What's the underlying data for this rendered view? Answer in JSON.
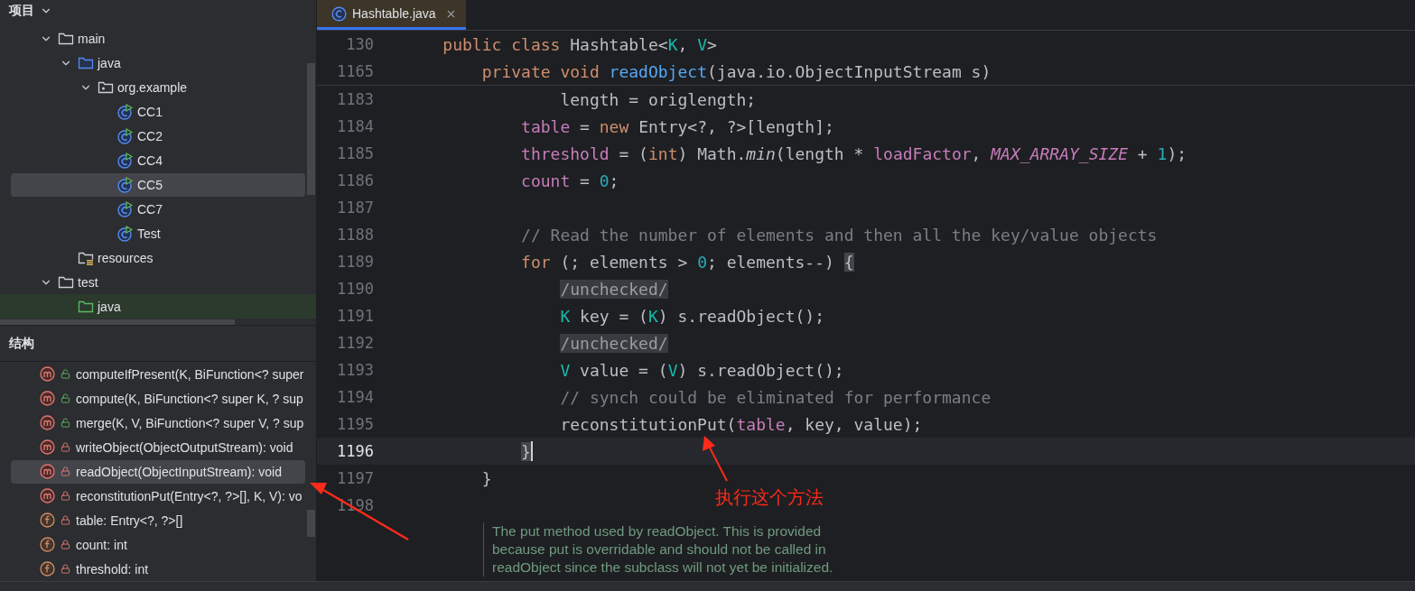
{
  "project_panel": {
    "title": "项目",
    "tree": [
      {
        "label": "main",
        "kind": "folder",
        "expanded": true,
        "selected": false,
        "children": [
          {
            "label": "java",
            "kind": "source-folder",
            "expanded": true,
            "selected": false,
            "children": [
              {
                "label": "org.example",
                "kind": "package",
                "expanded": true,
                "selected": false,
                "children": [
                  {
                    "label": "CC1",
                    "kind": "class",
                    "selected": false
                  },
                  {
                    "label": "CC2",
                    "kind": "class",
                    "selected": false
                  },
                  {
                    "label": "CC4",
                    "kind": "class",
                    "selected": false
                  },
                  {
                    "label": "CC5",
                    "kind": "class",
                    "selected": true
                  },
                  {
                    "label": "CC7",
                    "kind": "class",
                    "selected": false
                  },
                  {
                    "label": "Test",
                    "kind": "class",
                    "selected": false
                  }
                ]
              }
            ]
          },
          {
            "label": "resources",
            "kind": "resources-folder",
            "selected": false
          }
        ]
      },
      {
        "label": "test",
        "kind": "folder",
        "expanded": true,
        "selected": false,
        "children": [
          {
            "label": "java",
            "kind": "test-folder",
            "selected": false
          }
        ]
      }
    ]
  },
  "structure_panel": {
    "title": "结构",
    "items": [
      {
        "label": "computeIfPresent(K, BiFunction<? super",
        "kind": "method",
        "private": false,
        "selected": false
      },
      {
        "label": "compute(K, BiFunction<? super K, ? sup",
        "kind": "method",
        "private": false,
        "selected": false
      },
      {
        "label": "merge(K, V, BiFunction<? super V, ? sup",
        "kind": "method",
        "private": false,
        "selected": false
      },
      {
        "label": "writeObject(ObjectOutputStream): void",
        "kind": "method",
        "private": true,
        "selected": false
      },
      {
        "label": "readObject(ObjectInputStream): void",
        "kind": "method",
        "private": true,
        "selected": true
      },
      {
        "label": "reconstitutionPut(Entry<?, ?>[], K, V): vo",
        "kind": "method",
        "private": true,
        "selected": false
      },
      {
        "label": "table: Entry<?, ?>[]",
        "kind": "field",
        "private": true,
        "selected": false
      },
      {
        "label": "count: int",
        "kind": "field",
        "private": true,
        "selected": false
      },
      {
        "label": "threshold: int",
        "kind": "field",
        "private": true,
        "selected": false
      }
    ]
  },
  "editor": {
    "tabs": [
      {
        "label": "Hashtable.java",
        "selected": true
      }
    ],
    "sticky_lines": [
      {
        "number": "130",
        "tokens": [
          {
            "kind": "keyword",
            "text": "    public class"
          },
          {
            "kind": "plain",
            "text": " Hashtable<"
          },
          {
            "kind": "type-param",
            "text": "K"
          },
          {
            "kind": "plain",
            "text": ", "
          },
          {
            "kind": "type-param",
            "text": "V"
          },
          {
            "kind": "plain",
            "text": ">"
          }
        ]
      },
      {
        "number": "1165",
        "tokens": [
          {
            "kind": "keyword",
            "text": "        private void"
          },
          {
            "kind": "function",
            "text": " readObject"
          },
          {
            "kind": "plain",
            "text": "(java.io.ObjectInputStream s)"
          }
        ]
      }
    ],
    "lines": [
      {
        "number": "1183",
        "current": false,
        "tokens": [
          {
            "kind": "plain",
            "text": "                length = origlength;"
          }
        ]
      },
      {
        "number": "1184",
        "current": false,
        "tokens": [
          {
            "kind": "field",
            "text": "            table"
          },
          {
            "kind": "plain",
            "text": " = "
          },
          {
            "kind": "keyword",
            "text": "new"
          },
          {
            "kind": "plain",
            "text": " Entry<?, ?>[length];"
          }
        ]
      },
      {
        "number": "1185",
        "current": false,
        "tokens": [
          {
            "kind": "field",
            "text": "            threshold"
          },
          {
            "kind": "plain",
            "text": " = ("
          },
          {
            "kind": "keyword",
            "text": "int"
          },
          {
            "kind": "plain",
            "text": ") Math."
          },
          {
            "kind": "italic",
            "text": "min"
          },
          {
            "kind": "plain",
            "text": "(length * "
          },
          {
            "kind": "field",
            "text": "loadFactor"
          },
          {
            "kind": "plain",
            "text": ", "
          },
          {
            "kind": "constant",
            "text": "MAX_ARRAY_SIZE"
          },
          {
            "kind": "plain",
            "text": " + "
          },
          {
            "kind": "number",
            "text": "1"
          },
          {
            "kind": "plain",
            "text": ");"
          }
        ]
      },
      {
        "number": "1186",
        "current": false,
        "tokens": [
          {
            "kind": "field",
            "text": "            count"
          },
          {
            "kind": "plain",
            "text": " = "
          },
          {
            "kind": "number",
            "text": "0"
          },
          {
            "kind": "plain",
            "text": ";"
          }
        ]
      },
      {
        "number": "1187",
        "current": false
      },
      {
        "number": "1188",
        "current": false,
        "tokens": [
          {
            "kind": "comment",
            "text": "            // Read the number of elements and then all the key/value objects"
          }
        ]
      },
      {
        "number": "1189",
        "current": false,
        "tokens": [
          {
            "kind": "keyword",
            "text": "            for"
          },
          {
            "kind": "plain",
            "text": " (; elements > "
          },
          {
            "kind": "number",
            "text": "0"
          },
          {
            "kind": "plain",
            "text": "; elements--) "
          },
          {
            "kind": "brace-match",
            "text": "{"
          }
        ]
      },
      {
        "number": "1190",
        "current": false,
        "tokens": [
          {
            "kind": "inlay-hint",
            "text": "                /unchecked/"
          }
        ]
      },
      {
        "number": "1191",
        "current": false,
        "tokens": [
          {
            "kind": "type-param",
            "text": "                K"
          },
          {
            "kind": "plain",
            "text": " key = ("
          },
          {
            "kind": "type-param",
            "text": "K"
          },
          {
            "kind": "plain",
            "text": ") s.readObject();"
          }
        ]
      },
      {
        "number": "1192",
        "current": false,
        "tokens": [
          {
            "kind": "inlay-hint",
            "text": "                /unchecked/"
          }
        ]
      },
      {
        "number": "1193",
        "current": false,
        "tokens": [
          {
            "kind": "type-param",
            "text": "                V"
          },
          {
            "kind": "plain",
            "text": " value = ("
          },
          {
            "kind": "type-param",
            "text": "V"
          },
          {
            "kind": "plain",
            "text": ") s.readObject();"
          }
        ]
      },
      {
        "number": "1194",
        "current": false,
        "tokens": [
          {
            "kind": "comment",
            "text": "                // synch could be eliminated for performance"
          }
        ]
      },
      {
        "number": "1195",
        "current": false,
        "tokens": [
          {
            "kind": "plain",
            "text": "                reconstitutionPut("
          },
          {
            "kind": "field",
            "text": "table"
          },
          {
            "kind": "plain",
            "text": ", key, value);"
          }
        ]
      },
      {
        "number": "1196",
        "current": true,
        "tokens": [
          {
            "kind": "brace-match",
            "text": "            }"
          }
        ]
      },
      {
        "number": "1197",
        "current": false,
        "tokens": [
          {
            "kind": "plain",
            "text": "        }"
          }
        ]
      },
      {
        "number": "1198",
        "current": false
      }
    ],
    "doc_comment": [
      "The put method used by readObject. This is provided",
      "because put is overridable and should not be called in",
      "readObject since the subclass will not yet be initialized."
    ]
  },
  "annotation": {
    "text": "执行这个方法"
  }
}
